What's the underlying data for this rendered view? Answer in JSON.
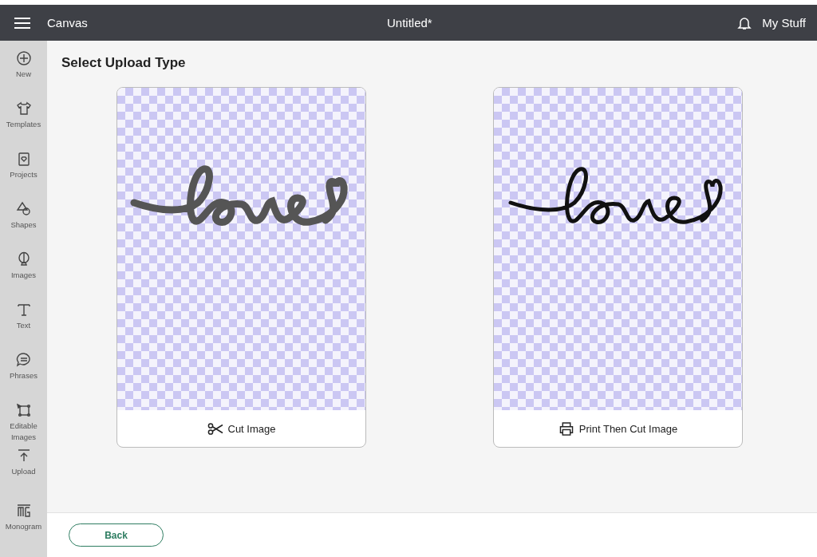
{
  "top_bar": {
    "app_name": "Canvas",
    "document_title": "Untitled*",
    "account_label": "My Stuff"
  },
  "sidebar": {
    "items": [
      {
        "label": "New",
        "kind": "plus"
      },
      {
        "label": "Templates",
        "kind": "shirt"
      },
      {
        "label": "Projects",
        "kind": "card"
      },
      {
        "label": "Shapes",
        "kind": "shapes"
      },
      {
        "label": "Images",
        "kind": "balloon"
      },
      {
        "label": "Text",
        "kind": "text"
      },
      {
        "label": "Phrases",
        "kind": "bubble"
      },
      {
        "label": "Editable Images",
        "kind": "edit"
      },
      {
        "label": "Upload",
        "kind": "upload"
      },
      {
        "label": "Monogram",
        "kind": "monogram"
      }
    ]
  },
  "page_title": "Select Upload Type",
  "options": [
    {
      "kind": "cut",
      "label": "Cut Image"
    },
    {
      "kind": "print-then-cut",
      "label": "Print Then Cut Image"
    }
  ],
  "footer": {
    "back_button": "Back"
  }
}
